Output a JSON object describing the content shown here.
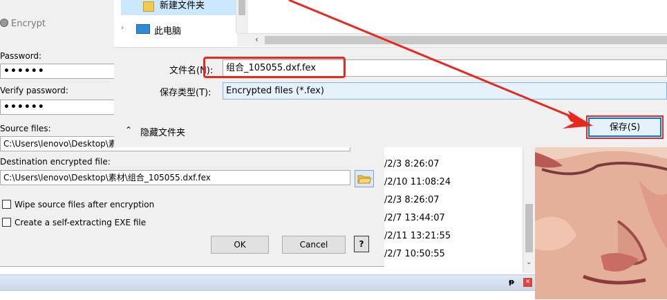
{
  "encrypt_dialog": {
    "title": "Encrypt",
    "password_label": "Password:",
    "password_value": "••••••",
    "verify_label": "Verify password:",
    "verify_value": "••••••",
    "source_label": "Source files:",
    "source_value": "C:\\Users\\lenovo\\Desktop\\素",
    "dest_label": "Destination encrypted file:",
    "dest_value": "C:\\Users\\lenovo\\Desktop\\素材\\组合_105055.dxf.fex",
    "wipe_label": "Wipe source files after encryption",
    "selfextract_label": "Create a self-extracting EXE file",
    "ok_label": "OK",
    "cancel_label": "Cancel"
  },
  "save_dialog": {
    "tree_items": [
      "新建文件夹",
      "此电脑"
    ],
    "filename_label": "文件名(N):",
    "filename_value": "组合_105055.dxf.fex",
    "filetype_label": "保存类型(T):",
    "filetype_value": "Encrypted files (*.fex)",
    "hide_folders_label": "隐藏文件夹",
    "save_label": "保存(S)"
  },
  "file_list": {
    "times": [
      "/2/3 8:26:07",
      "/2/10 11:08:24",
      "/2/3 8:26:07",
      "/2/7 13:44:07",
      "/2/11 13:21:55",
      "/2/7 10:50:55"
    ]
  },
  "panel": {
    "pin_glyph": "ᵽ",
    "close_glyph": "✕"
  },
  "annotation_color": "#e8271d"
}
